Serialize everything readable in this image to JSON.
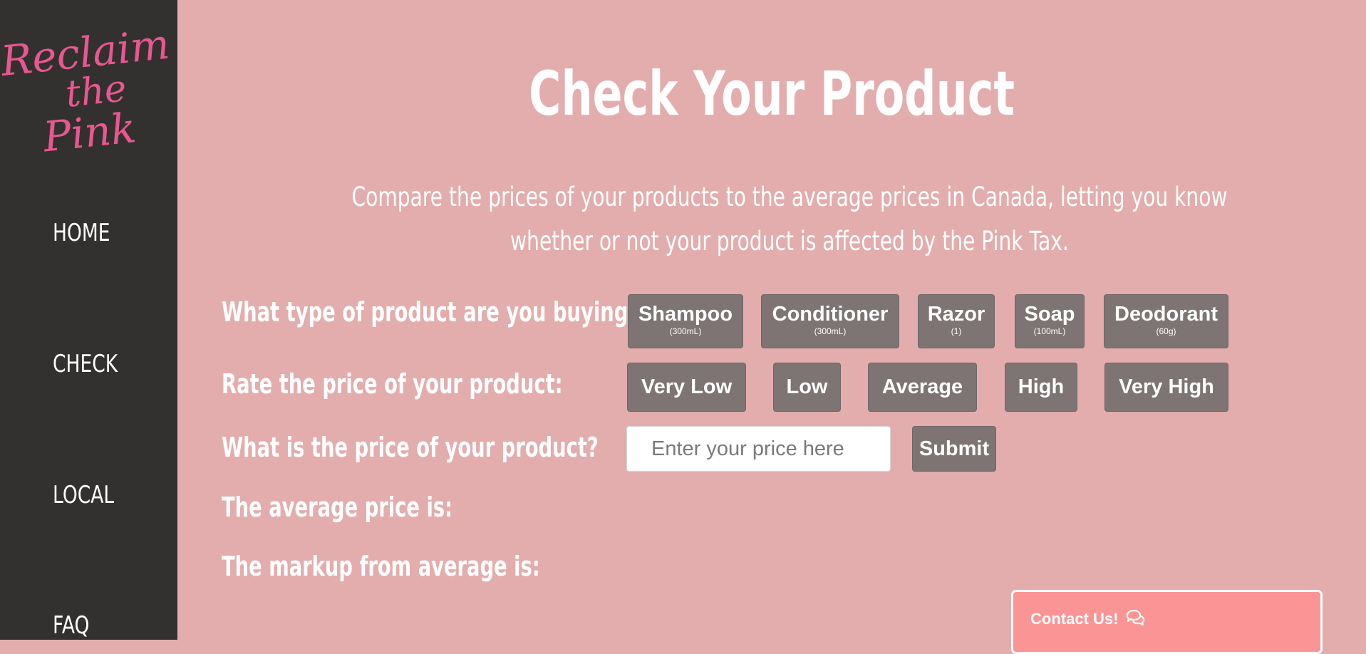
{
  "sidebar": {
    "logo": {
      "line1": "Reclaim",
      "line2": "the",
      "line3": "Pink",
      "color": "#ea5790"
    },
    "nav": [
      {
        "label": "HOME"
      },
      {
        "label": "CHECK"
      },
      {
        "label": "LOCAL"
      },
      {
        "label": "FAQ"
      }
    ]
  },
  "main": {
    "title": "Check Your Product",
    "description": "Compare the prices of your products to the average prices in Canada, letting you know whether or not your product is affected by the Pink Tax.",
    "questions": {
      "product_type": "What type of product are you buying?",
      "rate_price": "Rate the price of your product:",
      "price": "What is the price of your product?",
      "average": "The average price is:",
      "markup": "The markup from average is:"
    },
    "products": [
      {
        "label": "Shampoo",
        "size": "(300mL)"
      },
      {
        "label": "Conditioner",
        "size": "(300mL)"
      },
      {
        "label": "Razor",
        "size": "(1)"
      },
      {
        "label": "Soap",
        "size": "(100mL)"
      },
      {
        "label": "Deodorant",
        "size": "(60g)"
      }
    ],
    "ratings": [
      {
        "label": "Very Low"
      },
      {
        "label": "Low"
      },
      {
        "label": "Average"
      },
      {
        "label": "High"
      },
      {
        "label": "Very High"
      }
    ],
    "price_input": {
      "value": "",
      "placeholder": "Enter your price here"
    },
    "submit_label": "Submit"
  },
  "contact": {
    "label": "Contact Us!",
    "icon": "chat-bubbles-icon"
  },
  "colors": {
    "background": "#e3adad",
    "sidebar": "#333130",
    "button": "#7d7473",
    "contact": "#fb9595"
  }
}
